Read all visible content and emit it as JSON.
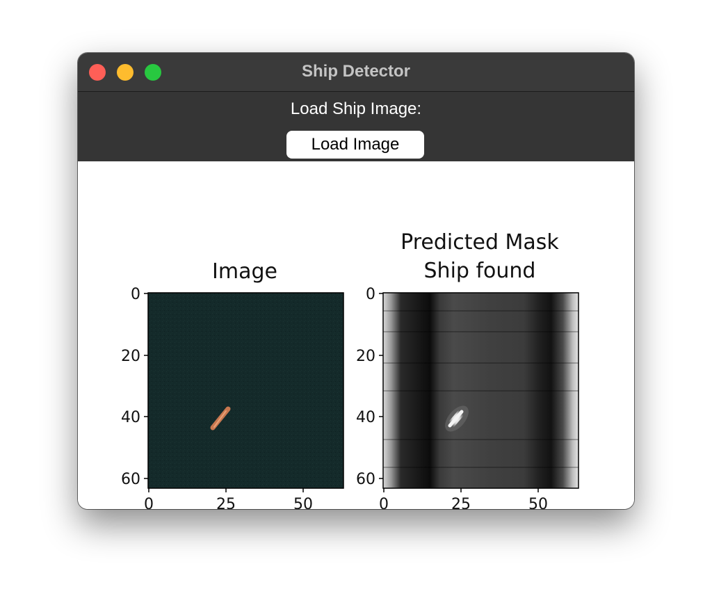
{
  "window": {
    "title": "Ship Detector"
  },
  "toolbar": {
    "load_label": "Load Ship Image:",
    "load_button_label": "Load Image"
  },
  "colors": {
    "titlebar": "#3a3a3a",
    "toolbar": "#353535",
    "close": "#ff5f57",
    "minimize": "#febc2e",
    "maximize": "#28c840",
    "image_background": "#142a2a",
    "ship": "#c87850"
  },
  "chart_data": [
    {
      "type": "heatmap",
      "title": "Image",
      "xticks": [
        "0",
        "25",
        "50"
      ],
      "yticks": [
        "0",
        "20",
        "40",
        "60"
      ],
      "xlim": [
        0,
        63
      ],
      "ylim": [
        63,
        0
      ]
    },
    {
      "type": "heatmap",
      "title": "Predicted Mask",
      "subtitle": "Ship found",
      "xticks": [
        "0",
        "25",
        "50"
      ],
      "yticks": [
        "0",
        "20",
        "40",
        "60"
      ],
      "xlim": [
        0,
        63
      ],
      "ylim": [
        63,
        0
      ]
    }
  ]
}
